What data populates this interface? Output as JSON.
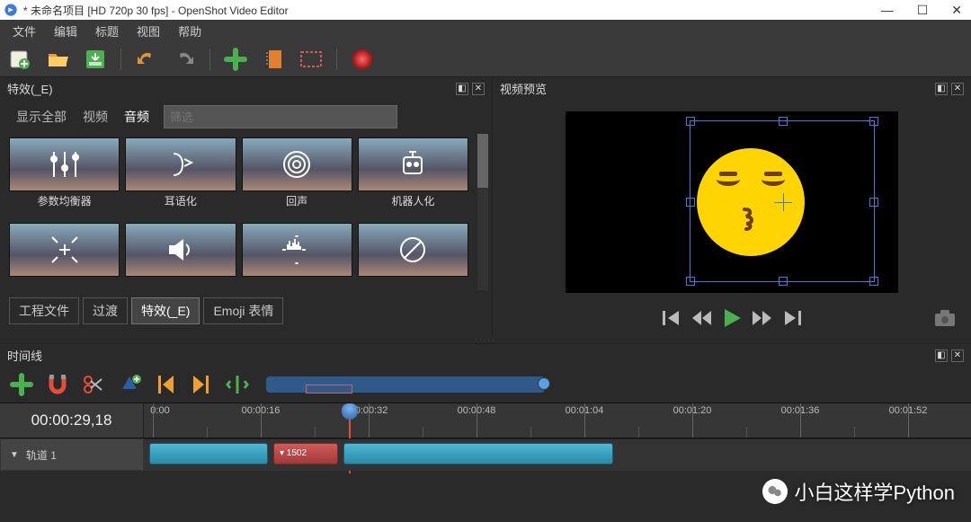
{
  "window": {
    "title": "* 未命名项目 [HD 720p 30 fps] - OpenShot Video Editor"
  },
  "menu": {
    "items": [
      "文件",
      "编辑",
      "标题",
      "视图",
      "帮助"
    ]
  },
  "panels": {
    "effects_title": "特效(_E)",
    "preview_title": "视频预览",
    "timeline_title": "时间线"
  },
  "effects_tabs": {
    "items": [
      "显示全部",
      "视频",
      "音频"
    ],
    "active": 2,
    "filter_placeholder": "筛选"
  },
  "effects": [
    {
      "label": "参数均衡器",
      "icon": "equalizer"
    },
    {
      "label": "耳语化",
      "icon": "whisper"
    },
    {
      "label": "回声",
      "icon": "echo"
    },
    {
      "label": "机器人化",
      "icon": "robot"
    },
    {
      "label": "",
      "icon": "expand"
    },
    {
      "label": "",
      "icon": "speaker"
    },
    {
      "label": "",
      "icon": "waveform"
    },
    {
      "label": "",
      "icon": "noentry"
    }
  ],
  "asset_tabs": {
    "items": [
      "工程文件",
      "过渡",
      "特效(_E)",
      "Emoji 表情"
    ],
    "active": 2
  },
  "timecode": "00:00:29,18",
  "ruler_marks": [
    "0:00",
    "00:00:16",
    "00:00:32",
    "00:00:48",
    "00:01:04",
    "00:01:20",
    "00:01:36",
    "00:01:52"
  ],
  "track": {
    "name": "轨道 1",
    "red_clip_label": "▾ 1502"
  },
  "watermark": "小白这样学Python"
}
